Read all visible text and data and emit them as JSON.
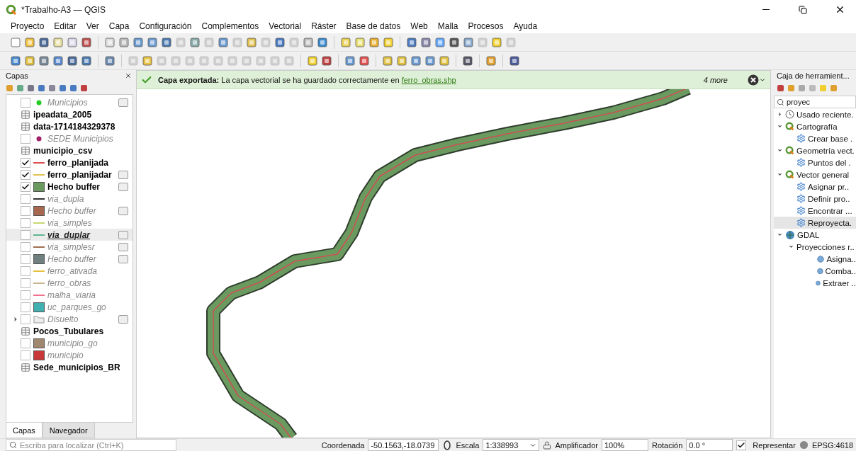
{
  "window": {
    "title": "*Trabalho-A3 — QGIS"
  },
  "menu": [
    "Proyecto",
    "Editar",
    "Ver",
    "Capa",
    "Configuración",
    "Complementos",
    "Vectorial",
    "Ráster",
    "Base de datos",
    "Web",
    "Malla",
    "Procesos",
    "Ayuda"
  ],
  "layers_panel": {
    "title": "Capas",
    "layers": [
      {
        "kind": "point",
        "name": "Municipios",
        "checked": false,
        "color": "#22cc22",
        "indicator": true,
        "selected": false
      },
      {
        "kind": "table",
        "name": "ipeadata_2005",
        "selected": false
      },
      {
        "kind": "table",
        "name": "data-1714184329378",
        "selected": false
      },
      {
        "kind": "point",
        "name": "SEDE Municipios",
        "checked": false,
        "color": "#a0206a",
        "indicator": false,
        "selected": false
      },
      {
        "kind": "table",
        "name": "municipio_csv",
        "selected": false
      },
      {
        "kind": "line",
        "name": "ferro_planijada",
        "checked": true,
        "color": "#e05050",
        "indicator": false,
        "selected": false
      },
      {
        "kind": "line",
        "name": "ferro_planijadar",
        "checked": true,
        "color": "#e0c050",
        "indicator": true,
        "selected": false
      },
      {
        "kind": "fill",
        "name": "Hecho buffer",
        "checked": true,
        "color": "#6a9a60",
        "indicator": true,
        "selected": false
      },
      {
        "kind": "line",
        "name": "via_dupla",
        "checked": false,
        "color": "#333333",
        "indicator": false,
        "selected": false
      },
      {
        "kind": "fill",
        "name": "Hecho buffer",
        "checked": false,
        "color": "#a86850",
        "indicator": true,
        "selected": false
      },
      {
        "kind": "line",
        "name": "via_simples",
        "checked": false,
        "color": "#c8d870",
        "indicator": false,
        "selected": false
      },
      {
        "kind": "line",
        "name": "via_duplar",
        "checked": false,
        "color": "#60b890",
        "indicator": true,
        "selected": true
      },
      {
        "kind": "line",
        "name": "via_simplesr",
        "checked": false,
        "color": "#a07050",
        "indicator": true,
        "selected": false
      },
      {
        "kind": "fill",
        "name": "Hecho buffer",
        "checked": false,
        "color": "#708080",
        "indicator": true,
        "selected": false
      },
      {
        "kind": "line",
        "name": "ferro_ativada",
        "checked": false,
        "color": "#e8c040",
        "indicator": false,
        "selected": false
      },
      {
        "kind": "line",
        "name": "ferro_obras",
        "checked": false,
        "color": "#c8b890",
        "indicator": false,
        "selected": false
      },
      {
        "kind": "line",
        "name": "malha_viaria",
        "checked": false,
        "color": "#f07090",
        "indicator": false,
        "selected": false
      },
      {
        "kind": "fill",
        "name": "uc_parques_go",
        "checked": false,
        "color": "#40b0b0",
        "indicator": false,
        "selected": false
      },
      {
        "kind": "group",
        "name": "Disuelto",
        "checked": false,
        "expanded": false,
        "indicator": true,
        "selected": false
      },
      {
        "kind": "table",
        "name": "Pocos_Tubulares",
        "selected": false
      },
      {
        "kind": "fill",
        "name": "municipio_go",
        "checked": false,
        "color": "#a08870",
        "indicator": false,
        "selected": false
      },
      {
        "kind": "fill",
        "name": "municipio",
        "checked": false,
        "color": "#c83838",
        "indicator": false,
        "selected": false
      },
      {
        "kind": "table",
        "name": "Sede_municipios_BR",
        "selected": false
      }
    ],
    "tabs": [
      {
        "label": "Capas",
        "selected": true
      },
      {
        "label": "Navegador",
        "selected": false
      }
    ]
  },
  "message": {
    "text": "**Capa exportada:** La capa vectorial se ha guardado correctamente en",
    "link": "ferro_obras.shp",
    "more": "4 more"
  },
  "toolbox": {
    "title": "Caja de herramient...",
    "search": "proyec",
    "tree": [
      {
        "kind": "recent",
        "label": "Usado reciente.",
        "expanded": false,
        "selected": false
      },
      {
        "kind": "provider",
        "label": "Cartografía",
        "expanded": true,
        "selected": false,
        "children": [
          {
            "kind": "algorithm",
            "label": "Crear base .",
            "selected": false
          }
        ]
      },
      {
        "kind": "provider",
        "label": "Geometría vect.",
        "expanded": true,
        "selected": false,
        "children": [
          {
            "kind": "algorithm",
            "label": "Puntos del .",
            "selected": false
          }
        ]
      },
      {
        "kind": "provider",
        "label": "Vector general",
        "expanded": true,
        "selected": false,
        "children": [
          {
            "kind": "algorithm",
            "label": "Asignar pr..",
            "selected": false
          },
          {
            "kind": "algorithm",
            "label": "Definir pro..",
            "selected": false
          },
          {
            "kind": "algorithm",
            "label": "Encontrar ...",
            "selected": false
          },
          {
            "kind": "algorithm",
            "label": "Reproyecta.",
            "selected": true
          }
        ]
      },
      {
        "kind": "gdal",
        "label": "GDAL",
        "expanded": true,
        "selected": false,
        "children": [
          {
            "kind": "folder",
            "label": "Proyecciones r..",
            "expanded": true,
            "selected": false,
            "children": [
              {
                "kind": "gdal-tool",
                "label": "Asigna..",
                "selected": false
              },
              {
                "kind": "gdal-tool",
                "label": "Comba..",
                "selected": false
              },
              {
                "kind": "gdal-tool",
                "label": "Extraer ..",
                "selected": false
              }
            ]
          }
        ]
      }
    ]
  },
  "status_bar": {
    "locate_placeholder": "Escriba para localizar (Ctrl+K)",
    "coordinate_label": "Coordenada",
    "coordinate": "-50.1563,-18.0739",
    "scale_label": "Escala",
    "scale": "1:338993",
    "magnifier_label": "Amplificador",
    "magnifier": "100%",
    "rotation_label": "Rotación",
    "rotation": "0.0 °",
    "render": {
      "label": "Representar",
      "checked": true
    },
    "crs": "EPSG:4618"
  }
}
